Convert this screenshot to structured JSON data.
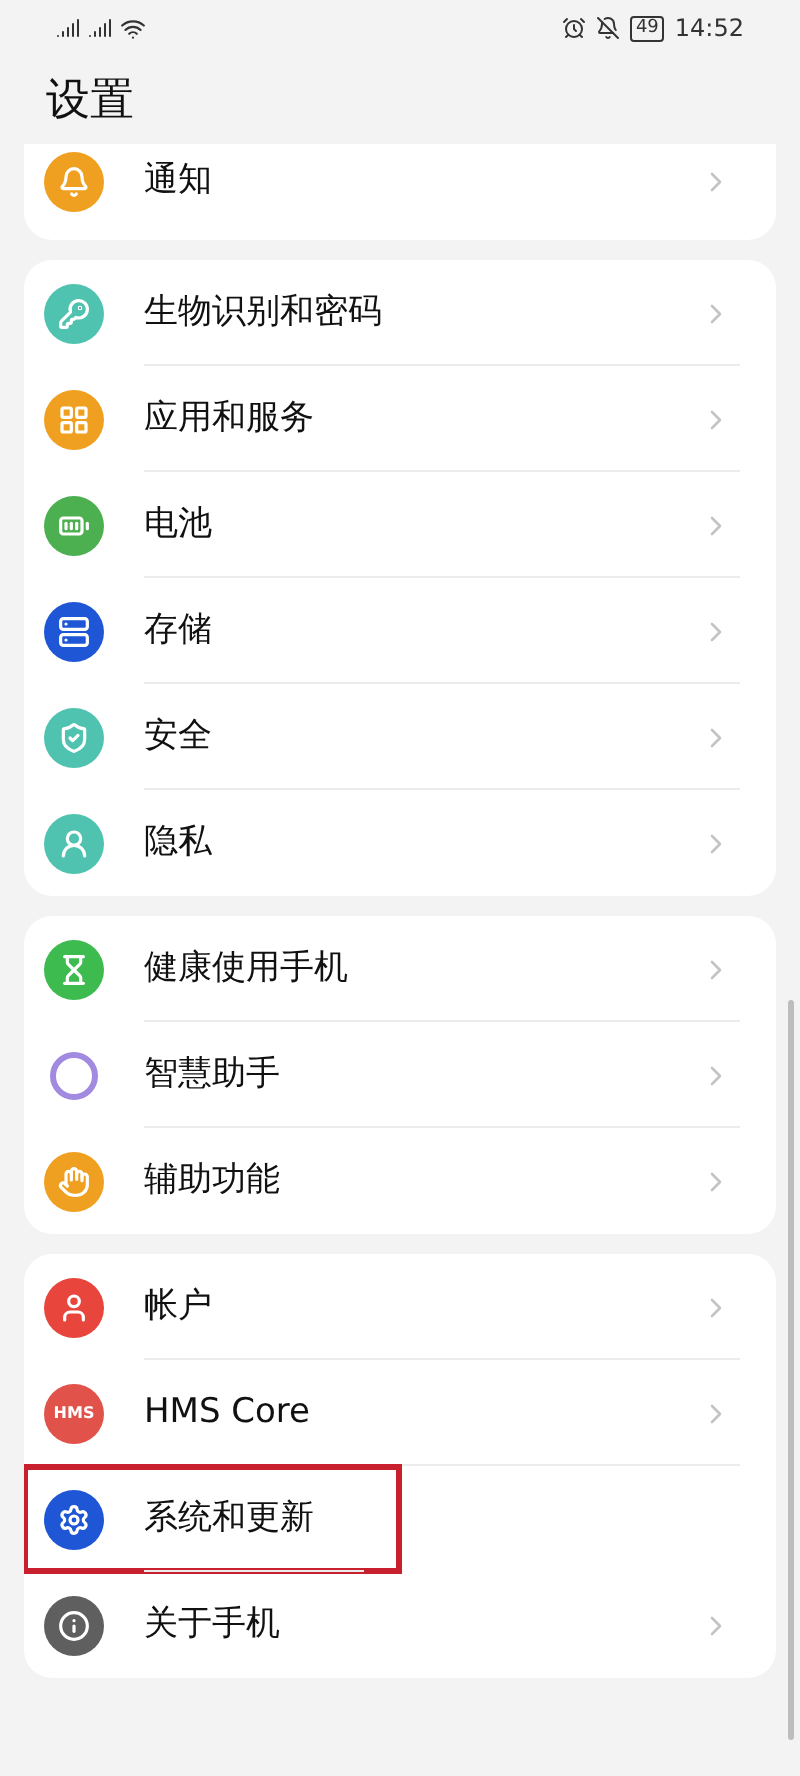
{
  "status_bar": {
    "battery": "49",
    "time": "14:52"
  },
  "title": "设置",
  "groups": [
    {
      "clipped": true,
      "items": [
        {
          "label": "通知",
          "kind": "bell",
          "color": "#f0a020",
          "highlighted": false
        }
      ]
    },
    {
      "clipped": false,
      "items": [
        {
          "label": "生物识别和密码",
          "kind": "key",
          "color": "#4fc3b0",
          "highlighted": false
        },
        {
          "label": "应用和服务",
          "kind": "grid",
          "color": "#f0a020",
          "highlighted": false
        },
        {
          "label": "电池",
          "kind": "battery",
          "color": "#4caf50",
          "highlighted": false
        },
        {
          "label": "存储",
          "kind": "storage",
          "color": "#1e56d6",
          "highlighted": false
        },
        {
          "label": "安全",
          "kind": "shield",
          "color": "#4fc3b0",
          "highlighted": false
        },
        {
          "label": "隐私",
          "kind": "privacy",
          "color": "#4fc3b0",
          "highlighted": false
        }
      ]
    },
    {
      "clipped": false,
      "items": [
        {
          "label": "健康使用手机",
          "kind": "hourglass",
          "color": "#3dbb4f",
          "highlighted": false
        },
        {
          "label": "智慧助手",
          "kind": "ring",
          "color": "#a28ae0",
          "highlighted": false
        },
        {
          "label": "辅助功能",
          "kind": "hand",
          "color": "#f0a020",
          "highlighted": false
        }
      ]
    },
    {
      "clipped": false,
      "items": [
        {
          "label": "帐户",
          "kind": "person",
          "color": "#e8453c",
          "highlighted": false
        },
        {
          "label": "HMS Core",
          "kind": "hms",
          "badge": "HMS",
          "color": "#e0524a",
          "highlighted": false
        },
        {
          "label": "系统和更新",
          "kind": "gear",
          "color": "#1e56d6",
          "highlighted": true
        },
        {
          "label": "关于手机",
          "kind": "info",
          "color": "#5f5f5f",
          "highlighted": false
        }
      ]
    }
  ]
}
